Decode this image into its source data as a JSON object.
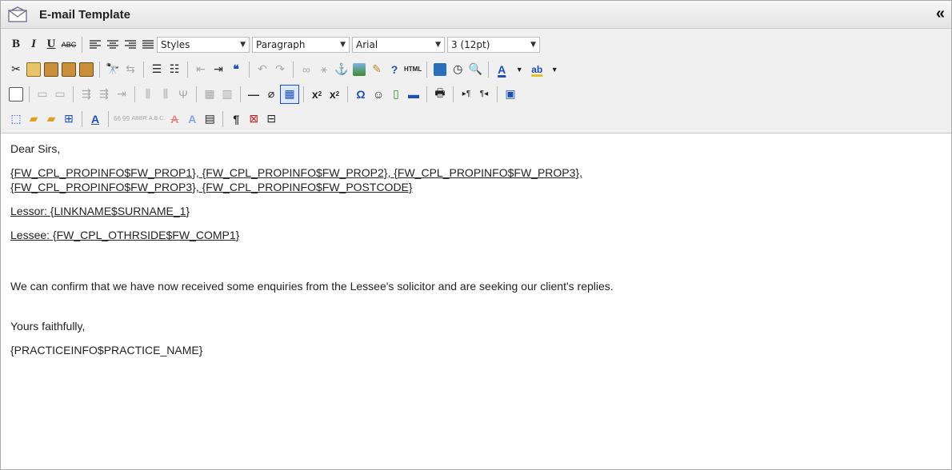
{
  "window": {
    "title": "E-mail Template",
    "collapse_glyph": "«"
  },
  "toolbar": {
    "row1": {
      "bold_label": "B",
      "italic_label": "I",
      "underline_label": "U",
      "strike_label": "ABC",
      "styles_value": "Styles",
      "format_value": "Paragraph",
      "font_value": "Arial",
      "size_value": "3 (12pt)"
    },
    "html_label": "HTML",
    "font_color_label": "A",
    "highlight_label": "ab",
    "sup_label": "x",
    "sub_label": "x",
    "omega_label": "Ω",
    "pilcrow_label": "¶",
    "acronym_label": "ABBR",
    "abbr_label": "A.B.C.",
    "cite_label": "66 99",
    "accent_color": "#1f4fb5",
    "icons": [
      "cut-icon",
      "copy-icon",
      "paste-icon",
      "paste-text-icon",
      "paste-word-icon",
      "find-icon",
      "replace-icon",
      "bullet-list-icon",
      "numbered-list-icon",
      "outdent-icon",
      "indent-icon",
      "blockquote-icon",
      "undo-icon",
      "redo-icon",
      "link-icon",
      "unlink-icon",
      "anchor-icon",
      "image-icon",
      "cleanup-icon",
      "help-icon",
      "html-icon",
      "insert-date-icon",
      "insert-time-icon",
      "preview-icon",
      "font-color-icon",
      "highlight-icon"
    ]
  },
  "content": {
    "greeting": "Dear Sirs,",
    "address_line1": "{FW_CPL_PROPINFO$FW_PROP1}, {FW_CPL_PROPINFO$FW_PROP2}, {FW_CPL_PROPINFO$FW_PROP3},",
    "address_line2": "{FW_CPL_PROPINFO$FW_PROP3}, {FW_CPL_PROPINFO$FW_POSTCODE}",
    "lessor": "Lessor: {LINKNAME$SURNAME_1}",
    "lessee": "Lessee: {FW_CPL_OTHRSIDE$FW_COMP1}",
    "body": "We can confirm that we have now received some enquiries from the Lessee's solicitor and are seeking our client's replies.",
    "signoff": "Yours faithfully,",
    "practice": "{PRACTICEINFO$PRACTICE_NAME}"
  }
}
